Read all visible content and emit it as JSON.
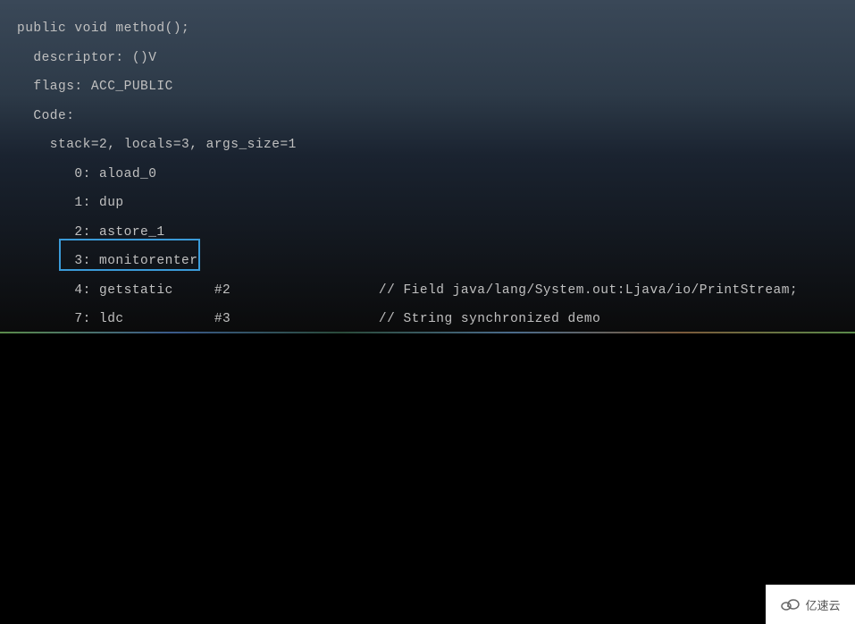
{
  "code": {
    "signature": "public void method();",
    "descriptor": "  descriptor: ()V",
    "flags": "  flags: ACC_PUBLIC",
    "code_label": "  Code:",
    "stack": "    stack=2, locals=3, args_size=1",
    "instructions": [
      "       0: aload_0",
      "       1: dup",
      "       2: astore_1",
      "       3: monitorenter",
      "       4: getstatic     #2                  // Field java/lang/System.out:Ljava/io/PrintStream;",
      "       7: ldc           #3                  // String synchronized demo"
    ]
  },
  "watermark": {
    "text": "亿速云"
  }
}
